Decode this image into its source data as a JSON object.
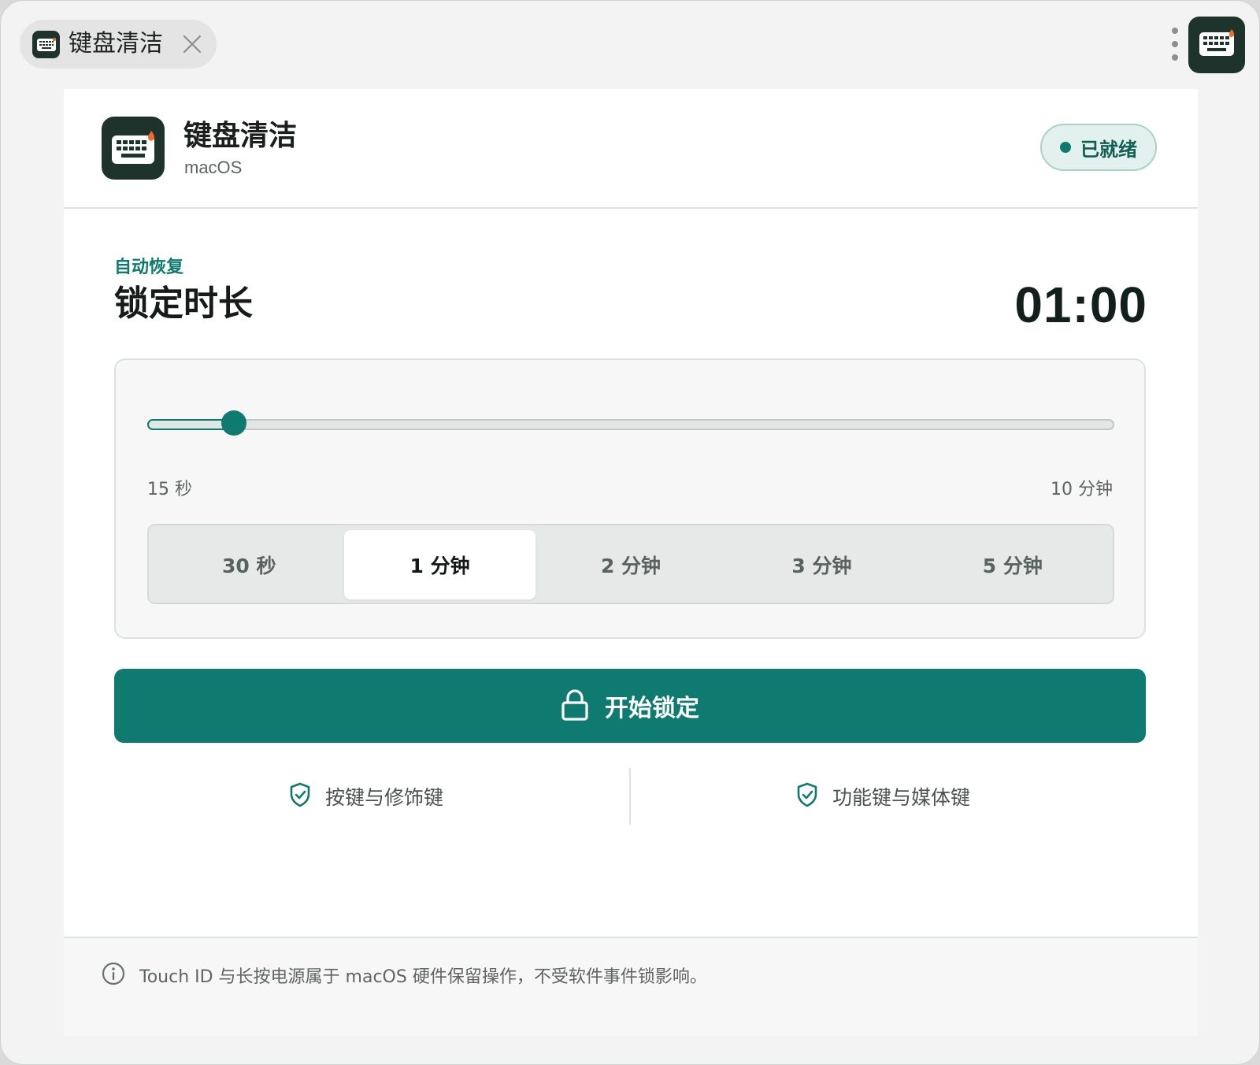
{
  "tab": {
    "label": "键盘清洁",
    "icon": "keyboard-icon",
    "close_icon": "close-icon"
  },
  "toolbar": {
    "more_icon": "kebab-icon",
    "app_icon": "keyboard-icon"
  },
  "app": {
    "title": "键盘清洁",
    "subtitle": "macOS",
    "icon": "keyboard-icon"
  },
  "status": {
    "label": "已就绪",
    "color": "#0f7a6f"
  },
  "duration": {
    "section_label": "自动恢复",
    "title": "锁定时长",
    "timer": "01:00",
    "slider": {
      "min_label": "15 秒",
      "max_label": "10 分钟",
      "min_seconds": 15,
      "max_seconds": 600,
      "value_seconds": 60
    },
    "presets": [
      {
        "label": "30 秒",
        "active": false
      },
      {
        "label": "1 分钟",
        "active": true
      },
      {
        "label": "2 分钟",
        "active": false
      },
      {
        "label": "3 分钟",
        "active": false
      },
      {
        "label": "5 分钟",
        "active": false
      }
    ]
  },
  "start_button": {
    "label": "开始锁定",
    "icon": "lock-icon"
  },
  "features": [
    {
      "label": "按键与修饰键",
      "icon": "shield-check-icon"
    },
    {
      "label": "功能键与媒体键",
      "icon": "shield-check-icon"
    }
  ],
  "footer": {
    "note": "Touch ID 与长按电源属于 macOS 硬件保留操作，不受软件事件锁影响。",
    "icon": "info-icon"
  },
  "colors": {
    "accent": "#0f7a6f",
    "dark": "#1d332c",
    "flame": "#f26b2a"
  }
}
